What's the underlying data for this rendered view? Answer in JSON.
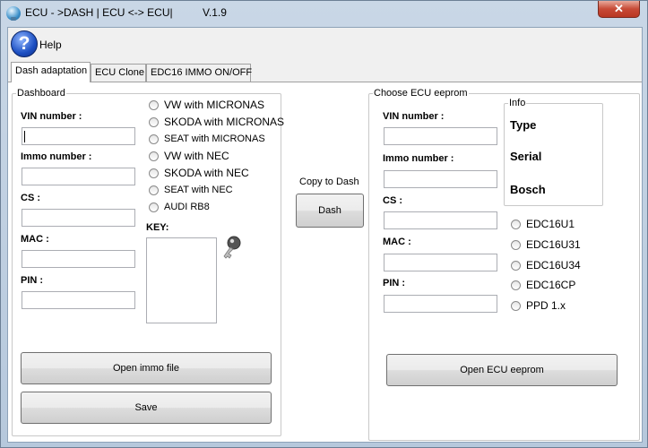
{
  "window": {
    "title": "ECU - >DASH | ECU <-> ECU|",
    "version": "V.1.9",
    "close_symbol": "✕"
  },
  "help": {
    "icon_symbol": "?",
    "label": "Help"
  },
  "tabs": [
    {
      "label": "Dash adaptation",
      "active": true
    },
    {
      "label": "ECU Clone",
      "active": false
    },
    {
      "label": "EDC16 IMMO ON/OFF",
      "active": false
    }
  ],
  "dashboard": {
    "group_title": "Dashboard",
    "fields": [
      {
        "label": "VIN number :",
        "value": ""
      },
      {
        "label": "Immo number :",
        "value": ""
      },
      {
        "label": "CS :",
        "value": ""
      },
      {
        "label": "MAC :",
        "value": ""
      },
      {
        "label": "PIN :",
        "value": ""
      }
    ],
    "radio_options": [
      "VW with MICRONAS",
      "SKODA with MICRONAS",
      "SEAT with MICRONAS",
      "VW with NEC",
      "SKODA with NEC",
      "SEAT with NEC",
      "AUDI RB8"
    ],
    "key_label": "KEY:",
    "open_button": "Open immo file",
    "save_button": "Save"
  },
  "middle": {
    "copy_label": "Copy to Dash",
    "dash_button": "Dash"
  },
  "ecu": {
    "group_title": "Choose ECU eeprom",
    "fields": [
      {
        "label": "VIN number :",
        "value": ""
      },
      {
        "label": "Immo number :",
        "value": ""
      },
      {
        "label": "CS :",
        "value": ""
      },
      {
        "label": "MAC :",
        "value": ""
      },
      {
        "label": "PIN :",
        "value": ""
      }
    ],
    "info": {
      "title": "Info",
      "type": "Type",
      "serial": "Serial",
      "bosch": "Bosch"
    },
    "radio_options": [
      "EDC16U1",
      "EDC16U31",
      "EDC16U34",
      "EDC16CP",
      "PPD 1.x"
    ],
    "open_button": "Open ECU eeprom"
  }
}
